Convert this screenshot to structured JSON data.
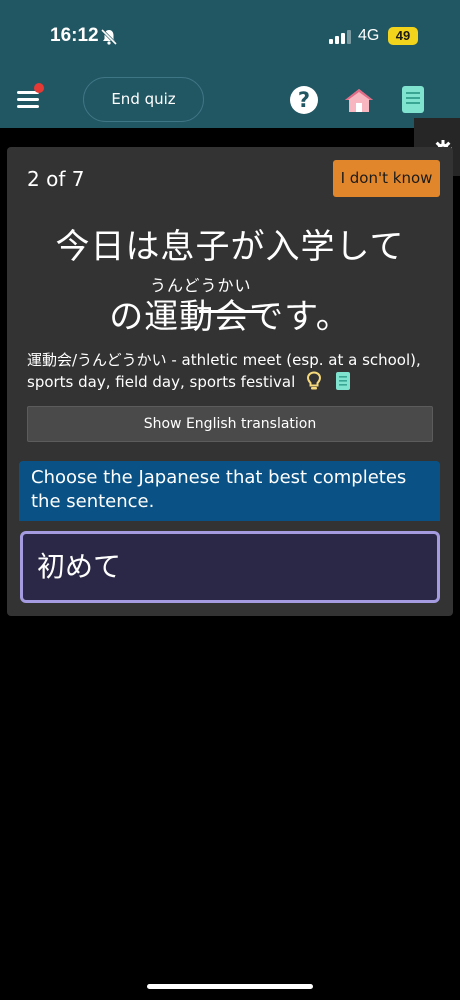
{
  "status": {
    "time": "16:12",
    "network": "4G",
    "battery": "49"
  },
  "nav": {
    "end_quiz_label": "End quiz",
    "help_glyph": "?",
    "icons": [
      "menu-icon",
      "help-icon",
      "home-icon",
      "book-icon",
      "gear-icon"
    ]
  },
  "quiz": {
    "progress": "2 of 7",
    "dont_know_label": "I don't know",
    "sentence_line1": "今日は息子が入学して",
    "furigana": "うんどうかい",
    "sentence_line2": "の運動会です。",
    "vocab_note": "運動会/うんどうかい - athletic meet (esp. at a school), sports day, field day, sports festival",
    "translate_label": "Show English translation",
    "prompt": "Choose the Japanese that best completes the sentence.",
    "answer": "初めて"
  },
  "colors": {
    "header": "#215663",
    "card": "#333333",
    "accent_orange": "#e2862b",
    "prompt_blue": "#0a5285",
    "answer_bg": "#2a2846",
    "answer_border": "#a59be0"
  }
}
